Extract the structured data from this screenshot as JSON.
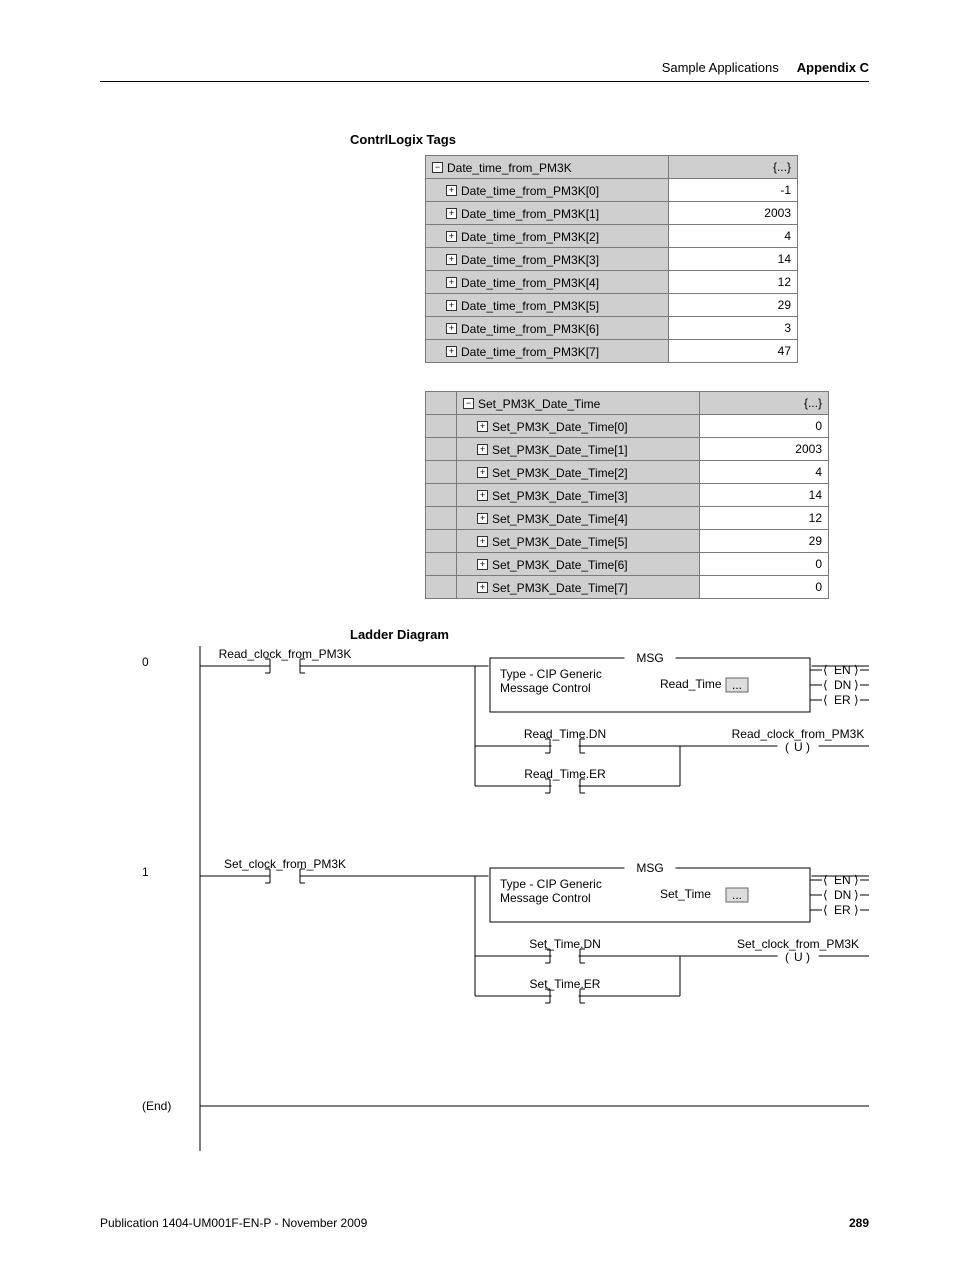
{
  "header": {
    "section": "Sample Applications",
    "appendix": "Appendix C"
  },
  "titles": {
    "tags": "ContrlLogix Tags",
    "ladder": "Ladder Diagram"
  },
  "tables": [
    {
      "parent": {
        "name": "Date_time_from_PM3K",
        "value": "{...}",
        "state": "minus"
      },
      "rows": [
        {
          "name": "Date_time_from_PM3K[0]",
          "value": "-1"
        },
        {
          "name": "Date_time_from_PM3K[1]",
          "value": "2003"
        },
        {
          "name": "Date_time_from_PM3K[2]",
          "value": "4"
        },
        {
          "name": "Date_time_from_PM3K[3]",
          "value": "14"
        },
        {
          "name": "Date_time_from_PM3K[4]",
          "value": "12"
        },
        {
          "name": "Date_time_from_PM3K[5]",
          "value": "29"
        },
        {
          "name": "Date_time_from_PM3K[6]",
          "value": "3"
        },
        {
          "name": "Date_time_from_PM3K[7]",
          "value": "47"
        }
      ],
      "gutter": false
    },
    {
      "parent": {
        "name": "Set_PM3K_Date_Time",
        "value": "{...}",
        "state": "minus"
      },
      "rows": [
        {
          "name": "Set_PM3K_Date_Time[0]",
          "value": "0"
        },
        {
          "name": "Set_PM3K_Date_Time[1]",
          "value": "2003"
        },
        {
          "name": "Set_PM3K_Date_Time[2]",
          "value": "4"
        },
        {
          "name": "Set_PM3K_Date_Time[3]",
          "value": "14"
        },
        {
          "name": "Set_PM3K_Date_Time[4]",
          "value": "12"
        },
        {
          "name": "Set_PM3K_Date_Time[5]",
          "value": "29"
        },
        {
          "name": "Set_PM3K_Date_Time[6]",
          "value": "0"
        },
        {
          "name": "Set_PM3K_Date_Time[7]",
          "value": "0"
        }
      ],
      "gutter": true
    }
  ],
  "ladder": {
    "rungs": [
      {
        "num": "0",
        "contact": "Read_clock_from_PM3K",
        "msg": {
          "title": "MSG",
          "line1": "Type - CIP Generic",
          "line2": "Message Control",
          "tag": "Read_Time",
          "btn": "...",
          "outs": [
            "EN",
            "DN",
            "ER"
          ]
        },
        "branch": {
          "a": "Read_Time.DN",
          "b": "Read_Time.ER",
          "coil": "Read_clock_from_PM3K",
          "coilType": "U"
        }
      },
      {
        "num": "1",
        "contact": "Set_clock_from_PM3K",
        "msg": {
          "title": "MSG",
          "line1": "Type - CIP Generic",
          "line2": "Message Control",
          "tag": "Set_Time",
          "btn": "...",
          "outs": [
            "EN",
            "DN",
            "ER"
          ]
        },
        "branch": {
          "a": "Set_Time.DN",
          "b": "Set_Time.ER",
          "coil": "Set_clock_from_PM3K",
          "coilType": "U"
        }
      }
    ],
    "end": "(End)"
  },
  "footer": {
    "pub": "Publication 1404-UM001F-EN-P - November 2009",
    "page": "289"
  }
}
